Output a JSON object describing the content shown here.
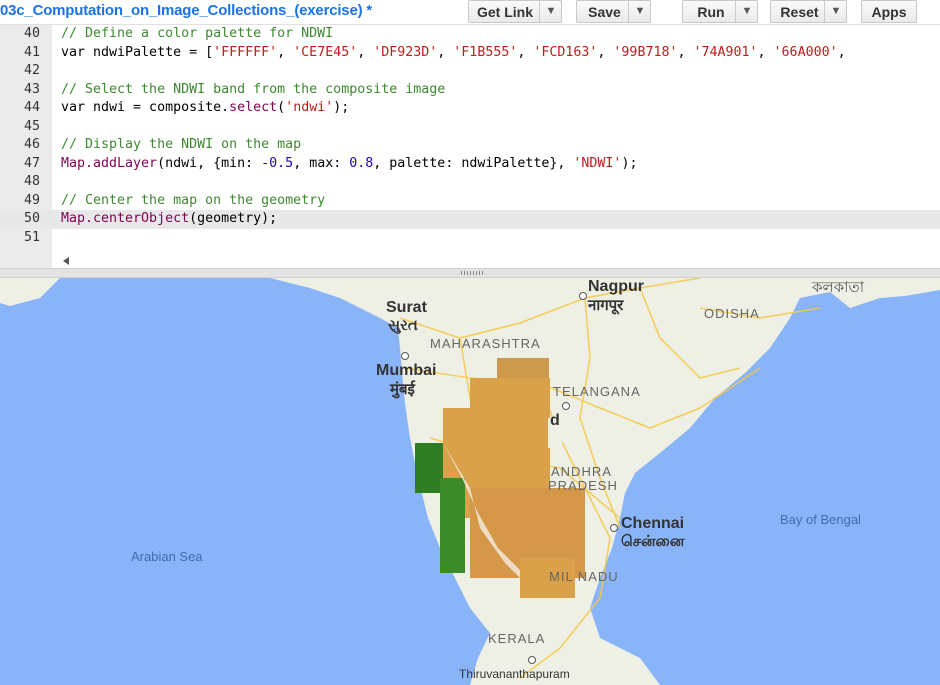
{
  "toolbar": {
    "title": "03c_Computation_on_Image_Collections_(exercise) *",
    "get_link": "Get Link",
    "save": "Save",
    "run": "Run",
    "reset": "Reset",
    "apps": "Apps",
    "dropdown_glyph": "▼"
  },
  "editor": {
    "lines": [
      {
        "num": "40",
        "parts": [
          {
            "t": "cm",
            "v": "// Define a color palette for NDWI"
          }
        ]
      },
      {
        "num": "41",
        "parts": [
          {
            "t": "",
            "v": "var ndwiPalette = ["
          },
          {
            "t": "str",
            "v": "'FFFFFF'"
          },
          {
            "t": "",
            "v": ", "
          },
          {
            "t": "str",
            "v": "'CE7E45'"
          },
          {
            "t": "",
            "v": ", "
          },
          {
            "t": "str",
            "v": "'DF923D'"
          },
          {
            "t": "",
            "v": ", "
          },
          {
            "t": "str",
            "v": "'F1B555'"
          },
          {
            "t": "",
            "v": ", "
          },
          {
            "t": "str",
            "v": "'FCD163'"
          },
          {
            "t": "",
            "v": ", "
          },
          {
            "t": "str",
            "v": "'99B718'"
          },
          {
            "t": "",
            "v": ", "
          },
          {
            "t": "str",
            "v": "'74A901'"
          },
          {
            "t": "",
            "v": ", "
          },
          {
            "t": "str",
            "v": "'66A000'"
          },
          {
            "t": "",
            "v": ","
          }
        ]
      },
      {
        "num": "42",
        "parts": []
      },
      {
        "num": "43",
        "parts": [
          {
            "t": "cm",
            "v": "// Select the NDWI band from the composite image"
          }
        ]
      },
      {
        "num": "44",
        "parts": [
          {
            "t": "",
            "v": "var ndwi = composite."
          },
          {
            "t": "fn",
            "v": "select"
          },
          {
            "t": "",
            "v": "("
          },
          {
            "t": "str",
            "v": "'ndwi'"
          },
          {
            "t": "",
            "v": ");"
          }
        ]
      },
      {
        "num": "45",
        "parts": []
      },
      {
        "num": "46",
        "parts": [
          {
            "t": "cm",
            "v": "// Display the NDWI on the map"
          }
        ]
      },
      {
        "num": "47",
        "parts": [
          {
            "t": "fn",
            "v": "Map.addLayer"
          },
          {
            "t": "",
            "v": "(ndwi, {min: "
          },
          {
            "t": "numv",
            "v": "-0.5"
          },
          {
            "t": "",
            "v": ", max: "
          },
          {
            "t": "numv",
            "v": "0.8"
          },
          {
            "t": "",
            "v": ", palette: ndwiPalette}, "
          },
          {
            "t": "str",
            "v": "'NDWI'"
          },
          {
            "t": "",
            "v": ");"
          }
        ]
      },
      {
        "num": "48",
        "parts": []
      },
      {
        "num": "49",
        "parts": [
          {
            "t": "cm",
            "v": "// Center the map on the geometry"
          }
        ]
      },
      {
        "num": "50",
        "active": true,
        "parts": [
          {
            "t": "fn",
            "v": "Map.centerObject"
          },
          {
            "t": "",
            "v": "(geometry);"
          }
        ]
      },
      {
        "num": "51",
        "parts": []
      }
    ]
  },
  "map": {
    "labels": [
      {
        "key": "nagpur",
        "text": "Nagpur"
      },
      {
        "key": "nagpur_local",
        "text": "नागपूर"
      },
      {
        "key": "kolkata_local",
        "text": "কলকাতা"
      },
      {
        "key": "surat",
        "text": "Surat"
      },
      {
        "key": "surat_local",
        "text": "સુરત"
      },
      {
        "key": "odisha",
        "text": "ODISHA"
      },
      {
        "key": "maharashtra",
        "text": "MAHARASHTRA"
      },
      {
        "key": "mumbai",
        "text": "Mumbai"
      },
      {
        "key": "mumbai_local",
        "text": "मुंबई"
      },
      {
        "key": "telangana",
        "text": "TELANGANA"
      },
      {
        "key": "hyd_fragment",
        "text": "d"
      },
      {
        "key": "andhra",
        "text": "ANDHRA"
      },
      {
        "key": "pradesh",
        "text": "PRADESH"
      },
      {
        "key": "chennai",
        "text": "Chennai"
      },
      {
        "key": "chennai_local",
        "text": "சென்னை"
      },
      {
        "key": "bay_of_bengal",
        "text": "Bay of Bengal"
      },
      {
        "key": "arabian_sea",
        "text": "Arabian Sea"
      },
      {
        "key": "tamil_nadu",
        "text": "MIL NADU"
      },
      {
        "key": "kerala",
        "text": "KERALA"
      },
      {
        "key": "thiruvananthapuram",
        "text": "Thiruvananthapuram"
      }
    ],
    "colors": {
      "sea": "#8ab4f8",
      "land": "#eef0e6",
      "ndwi_dry": "#d9a24a",
      "ndwi_wet": "#3d8a2a",
      "road": "#f6c945"
    }
  }
}
